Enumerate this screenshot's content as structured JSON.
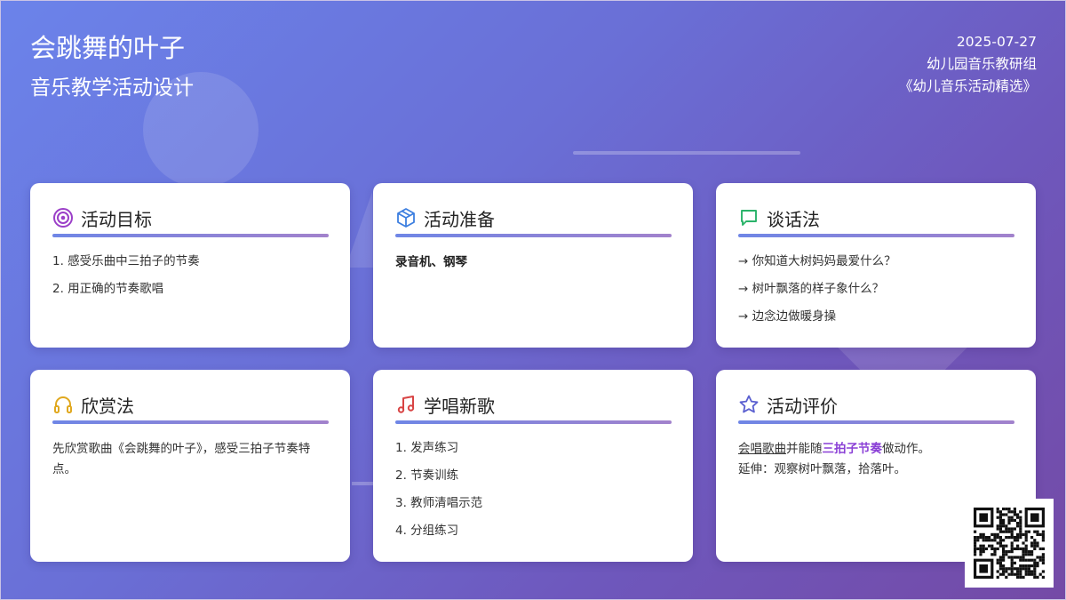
{
  "header": {
    "title": "会跳舞的叶子",
    "subtitle": "音乐教学活动设计",
    "date": "2025-07-27",
    "author": "幼儿园音乐教研组",
    "source": "《幼儿音乐活动精选》"
  },
  "cards": {
    "goals": {
      "title": "活动目标",
      "icon": "target-icon",
      "items": [
        "1. 感受乐曲中三拍子的节奏",
        "2. 用正确的节奏歌唱"
      ]
    },
    "prep": {
      "title": "活动准备",
      "icon": "box-icon",
      "text": "录音机、钢琴"
    },
    "talk": {
      "title": "谈话法",
      "icon": "chat-icon",
      "items": [
        "→ 你知道大树妈妈最爱什么？",
        "→ 树叶飘落的样子象什么？",
        "→ 边念边做暖身操"
      ]
    },
    "appreciate": {
      "title": "欣赏法",
      "icon": "headphones-icon",
      "text": "先欣赏歌曲《会跳舞的叶子》，感受三拍子节奏特点。"
    },
    "sing": {
      "title": "学唱新歌",
      "icon": "music-note-icon",
      "items": [
        "1. 发声练习",
        "2. 节奏训练",
        "3. 教师清唱示范",
        "4. 分组练习"
      ]
    },
    "eval": {
      "title": "活动评价",
      "icon": "star-icon",
      "part1": "会唱歌曲",
      "part2": "并能随",
      "part3": "三拍子节奏",
      "part4": "做动作。",
      "line2": "延伸：观察树叶飘落，拾落叶。"
    }
  },
  "colors": {
    "accent_purple": "#8a3fd6",
    "rule_start": "#6f86e6",
    "rule_end": "#a282cc"
  }
}
